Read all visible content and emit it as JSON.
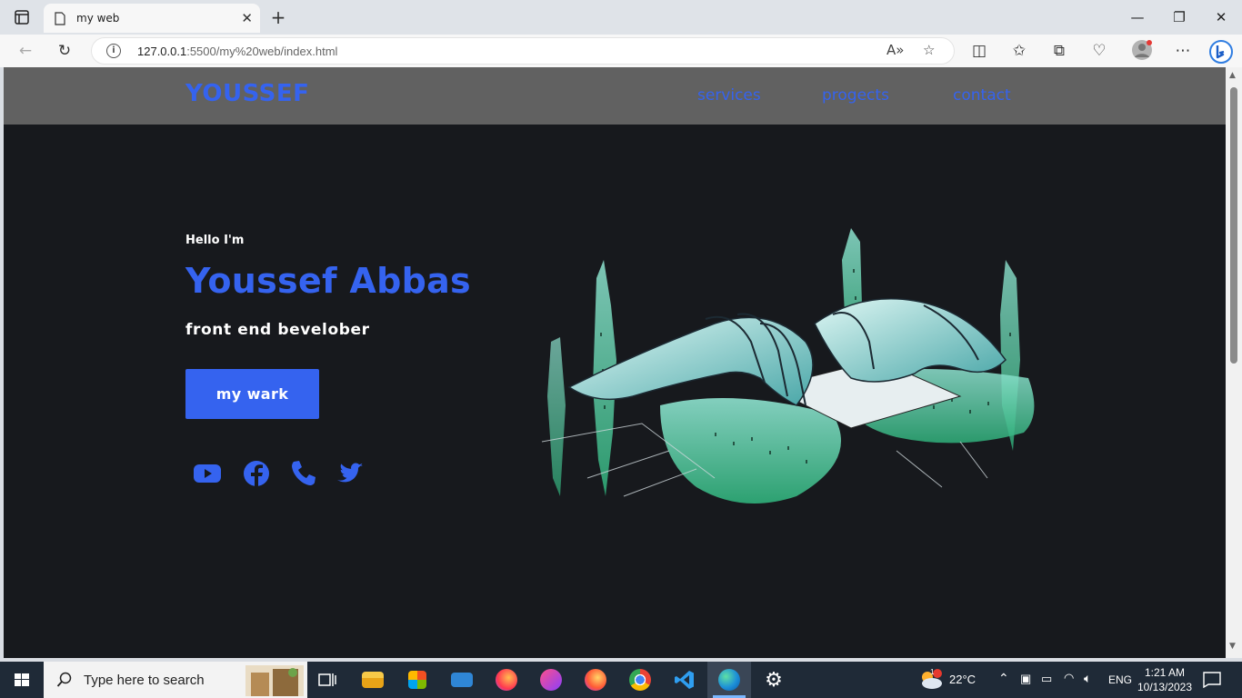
{
  "browser": {
    "tab_title": "my web",
    "tab_close": "✕",
    "new_tab": "+",
    "url_host": "127.0.0.1",
    "url_path": ":5500/my%20web/index.html",
    "window_controls": {
      "minimize": "—",
      "restore": "❐",
      "close": "✕"
    }
  },
  "site": {
    "logo": "YOUSSEF",
    "nav": [
      "services",
      "progects",
      "contact"
    ],
    "hero": {
      "greeting": "Hello I'm",
      "name": "Youssef Abbas",
      "role": "front end bevelober",
      "cta": "my wark"
    },
    "social_icons": [
      "youtube-icon",
      "facebook-icon",
      "phone-icon",
      "twitter-icon"
    ],
    "accent_color": "#3563ef",
    "header_color": "#616161",
    "background_color": "#17191d"
  },
  "taskbar": {
    "search_placeholder": "Type here to search",
    "weather": "22°C",
    "language": "ENG",
    "time": "1:21 AM",
    "date": "10/13/2023",
    "weather_badge": "1"
  }
}
